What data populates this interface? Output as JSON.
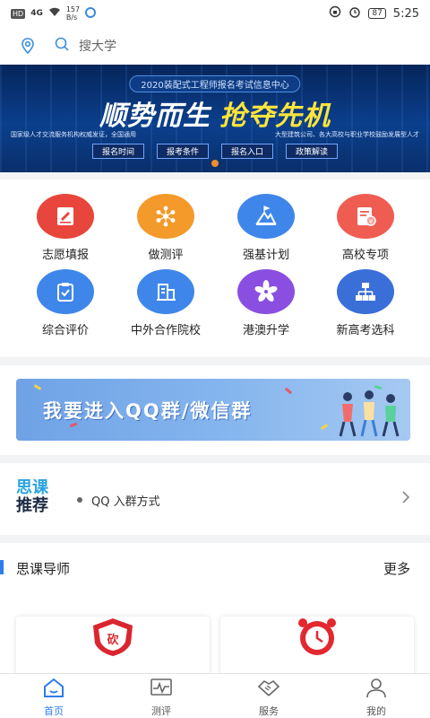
{
  "status_bar": {
    "hd": "HD",
    "network": "4G",
    "speed_value": "157",
    "speed_unit": "B/s",
    "battery": "87",
    "time": "5:25"
  },
  "search": {
    "placeholder": "搜大学"
  },
  "banner": {
    "tag": "2020装配式工程师报名考试信息中心",
    "title_part1": "顺势而生",
    "title_part2": "抢夺先机",
    "sub_left": "国家级人才交流服务机构权威发证，全国通用",
    "sub_right": "大型建筑公司、各大高校与职业学校鼓励发展型人才",
    "chips": [
      "报名时间",
      "报考条件",
      "报名入口",
      "政策解读"
    ]
  },
  "features": [
    {
      "label": "志愿填报",
      "icon": "form-edit-icon",
      "color": "#e8453c"
    },
    {
      "label": "做测评",
      "icon": "molecule-icon",
      "color": "#f39a2b"
    },
    {
      "label": "强基计划",
      "icon": "mountain-flag-icon",
      "color": "#3f86ea"
    },
    {
      "label": "高校专项",
      "icon": "document-badge-icon",
      "color": "#ef5d52"
    },
    {
      "label": "综合评价",
      "icon": "clipboard-check-icon",
      "color": "#3f86ea"
    },
    {
      "label": "中外合作院校",
      "icon": "building-icon",
      "color": "#3f86ea"
    },
    {
      "label": "港澳升学",
      "icon": "bauhinia-flower-icon",
      "color": "#8a4fe0"
    },
    {
      "label": "新高考选科",
      "icon": "org-chart-icon",
      "color": "#3a6fd8"
    }
  ],
  "group_banner": {
    "text": "我要进入QQ群/微信群"
  },
  "recommend": {
    "logo_line1": "思课",
    "logo_line2": "推荐",
    "text": "QQ 入群方式"
  },
  "tutors": {
    "title": "思课导师",
    "more": "更多",
    "card1_badge": "砍"
  },
  "bottom_nav": [
    {
      "label": "首页",
      "icon": "home-icon"
    },
    {
      "label": "测评",
      "icon": "chart-monitor-icon"
    },
    {
      "label": "服务",
      "icon": "handshake-icon"
    },
    {
      "label": "我的",
      "icon": "user-icon"
    }
  ],
  "colors": {
    "accent": "#2d7ee8",
    "banner_yellow": "#ffe53b",
    "banner_bg": "#0b3f8c"
  }
}
